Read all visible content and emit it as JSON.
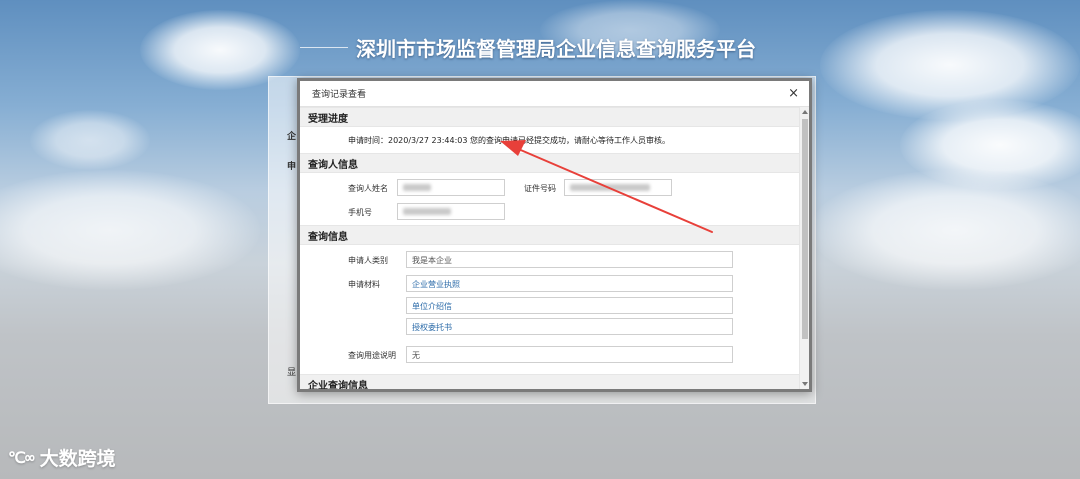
{
  "site": {
    "title": "深圳市市场监督管理局企业信息查询服务平台"
  },
  "modal": {
    "title": "查询记录查看",
    "close": "×",
    "sections": {
      "progress": {
        "heading": "受理进度",
        "status": "申请时间：2020/3/27 23:44:03 您的查询申请已经提交成功，请耐心等待工作人员审核。"
      },
      "requester": {
        "heading": "查询人信息",
        "name_label": "查询人姓名",
        "id_label": "证件号码",
        "phone_label": "手机号"
      },
      "query": {
        "heading": "查询信息",
        "type_label": "申请人类别",
        "type_value": "我是本企业",
        "materials_label": "申请材料",
        "materials": [
          "企业营业执照",
          "单位介绍信",
          "授权委托书"
        ],
        "purpose_label": "查询用途说明",
        "purpose_value": "无"
      },
      "company": {
        "heading": "企业查询信息"
      }
    }
  },
  "background_fragments": {
    "frag1": "企",
    "frag2": "申",
    "frag3": "显"
  },
  "watermark": {
    "logo": "℃∞",
    "text": "大数跨境"
  },
  "colors": {
    "arrow": "#e8403a",
    "link_text": "#2a6aa8"
  }
}
